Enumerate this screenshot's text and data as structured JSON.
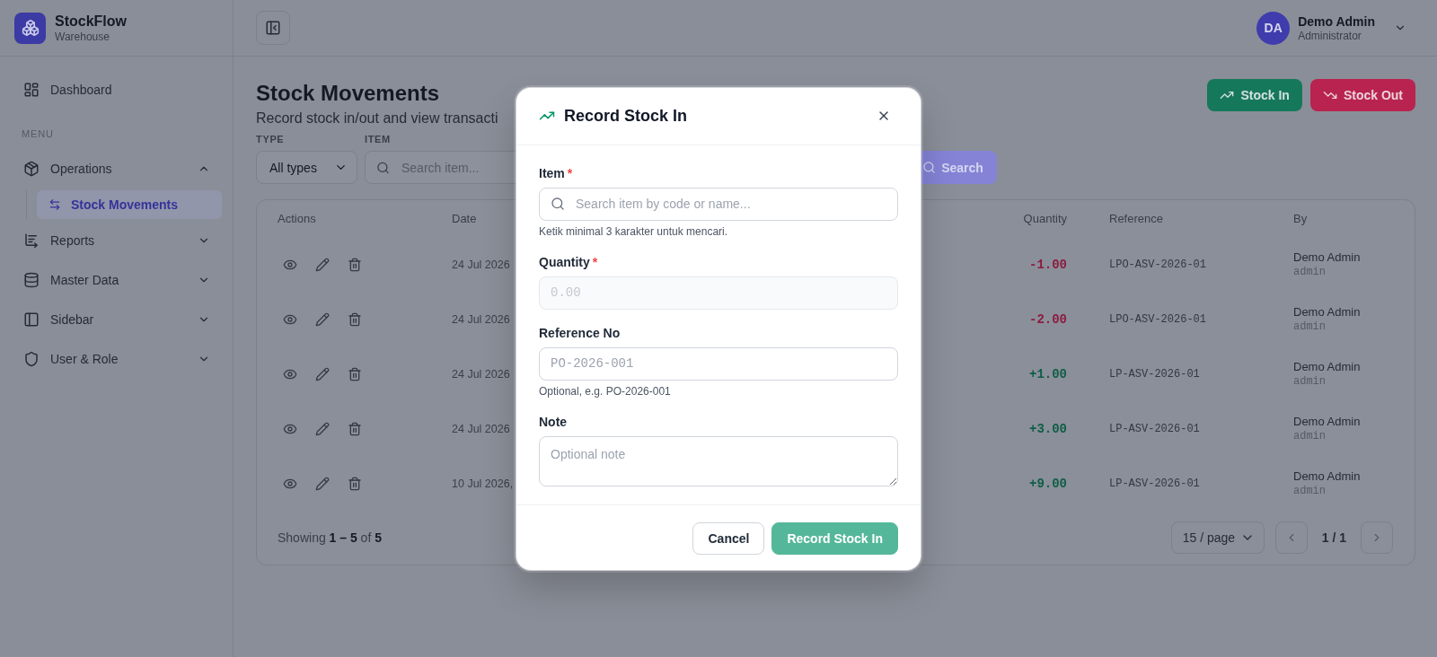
{
  "sidebar": {
    "brand": {
      "name": "StockFlow",
      "subtitle": "Warehouse"
    },
    "top_items": [
      {
        "label": "Dashboard",
        "selected": false
      }
    ],
    "section_label": "MENU",
    "groups": [
      {
        "label": "Operations",
        "expanded": true,
        "children": [
          {
            "label": "Stock Movements",
            "selected": true
          }
        ]
      },
      {
        "label": "Reports",
        "expanded": false
      },
      {
        "label": "Master Data",
        "expanded": false
      },
      {
        "label": "Sidebar",
        "expanded": false
      },
      {
        "label": "User & Role",
        "expanded": false
      }
    ]
  },
  "header": {
    "user": {
      "initials": "DA",
      "name": "Demo Admin",
      "role": "Administrator"
    }
  },
  "page": {
    "title": "Stock Movements",
    "subtitle": "Record stock in/out and view transacti",
    "actions": [
      {
        "label": "Stock In",
        "kind": "in"
      },
      {
        "label": "Stock Out",
        "kind": "out"
      }
    ]
  },
  "filters": {
    "type": {
      "label": "TYPE",
      "value": "All types"
    },
    "item": {
      "label": "ITEM",
      "placeholder": "Search item..."
    },
    "search_button": "Search"
  },
  "table": {
    "columns": [
      "Actions",
      "Date",
      "Quantity",
      "Reference",
      "By"
    ],
    "rows": [
      {
        "date": "24 Jul 2026",
        "quantity": "-1.00",
        "kind": "out",
        "reference": "LPO-ASV-2026-01",
        "by": "Demo Admin",
        "login": "admin"
      },
      {
        "date": "24 Jul 2026",
        "quantity": "-2.00",
        "kind": "out",
        "reference": "LPO-ASV-2026-01",
        "by": "Demo Admin",
        "login": "admin"
      },
      {
        "date": "24 Jul 2026",
        "quantity": "+1.00",
        "kind": "in",
        "reference": "LP-ASV-2026-01",
        "by": "Demo Admin",
        "login": "admin"
      },
      {
        "date": "24 Jul 2026",
        "quantity": "+3.00",
        "kind": "in",
        "reference": "LP-ASV-2026-01",
        "by": "Demo Admin",
        "login": "admin"
      },
      {
        "date": "10 Jul 2026,",
        "quantity": "+9.00",
        "kind": "in",
        "reference": "LP-ASV-2026-01",
        "by": "Demo Admin",
        "login": "admin"
      }
    ],
    "footer": {
      "summary": "Showing **1 – 5** of **5**",
      "page_size": "15 / page",
      "page": "1 / 1"
    }
  },
  "dialog": {
    "kind": "in",
    "title": "Record Stock In",
    "fields": [
      {
        "kind": "search",
        "label": "Item",
        "required_mark": "*",
        "placeholder": "Search item by code or name...",
        "hint": "Ketik minimal 3 karakter untuk mencari.",
        "disabled": false
      },
      {
        "kind": "number",
        "label": "Quantity",
        "required_mark": "*",
        "placeholder": "0.00",
        "disabled": true
      },
      {
        "kind": "reference",
        "label": "Reference No",
        "placeholder": "PO-2026-001",
        "hint": "Optional, e.g. PO-2026-001",
        "disabled": false
      },
      {
        "kind": "textarea",
        "label": "Note",
        "placeholder": "Optional note",
        "disabled": false
      }
    ],
    "buttons": [
      {
        "label": "Cancel",
        "kind": "secondary",
        "disabled": false
      },
      {
        "label": "Record Stock In",
        "kind": "primary",
        "disabled": true
      }
    ]
  }
}
